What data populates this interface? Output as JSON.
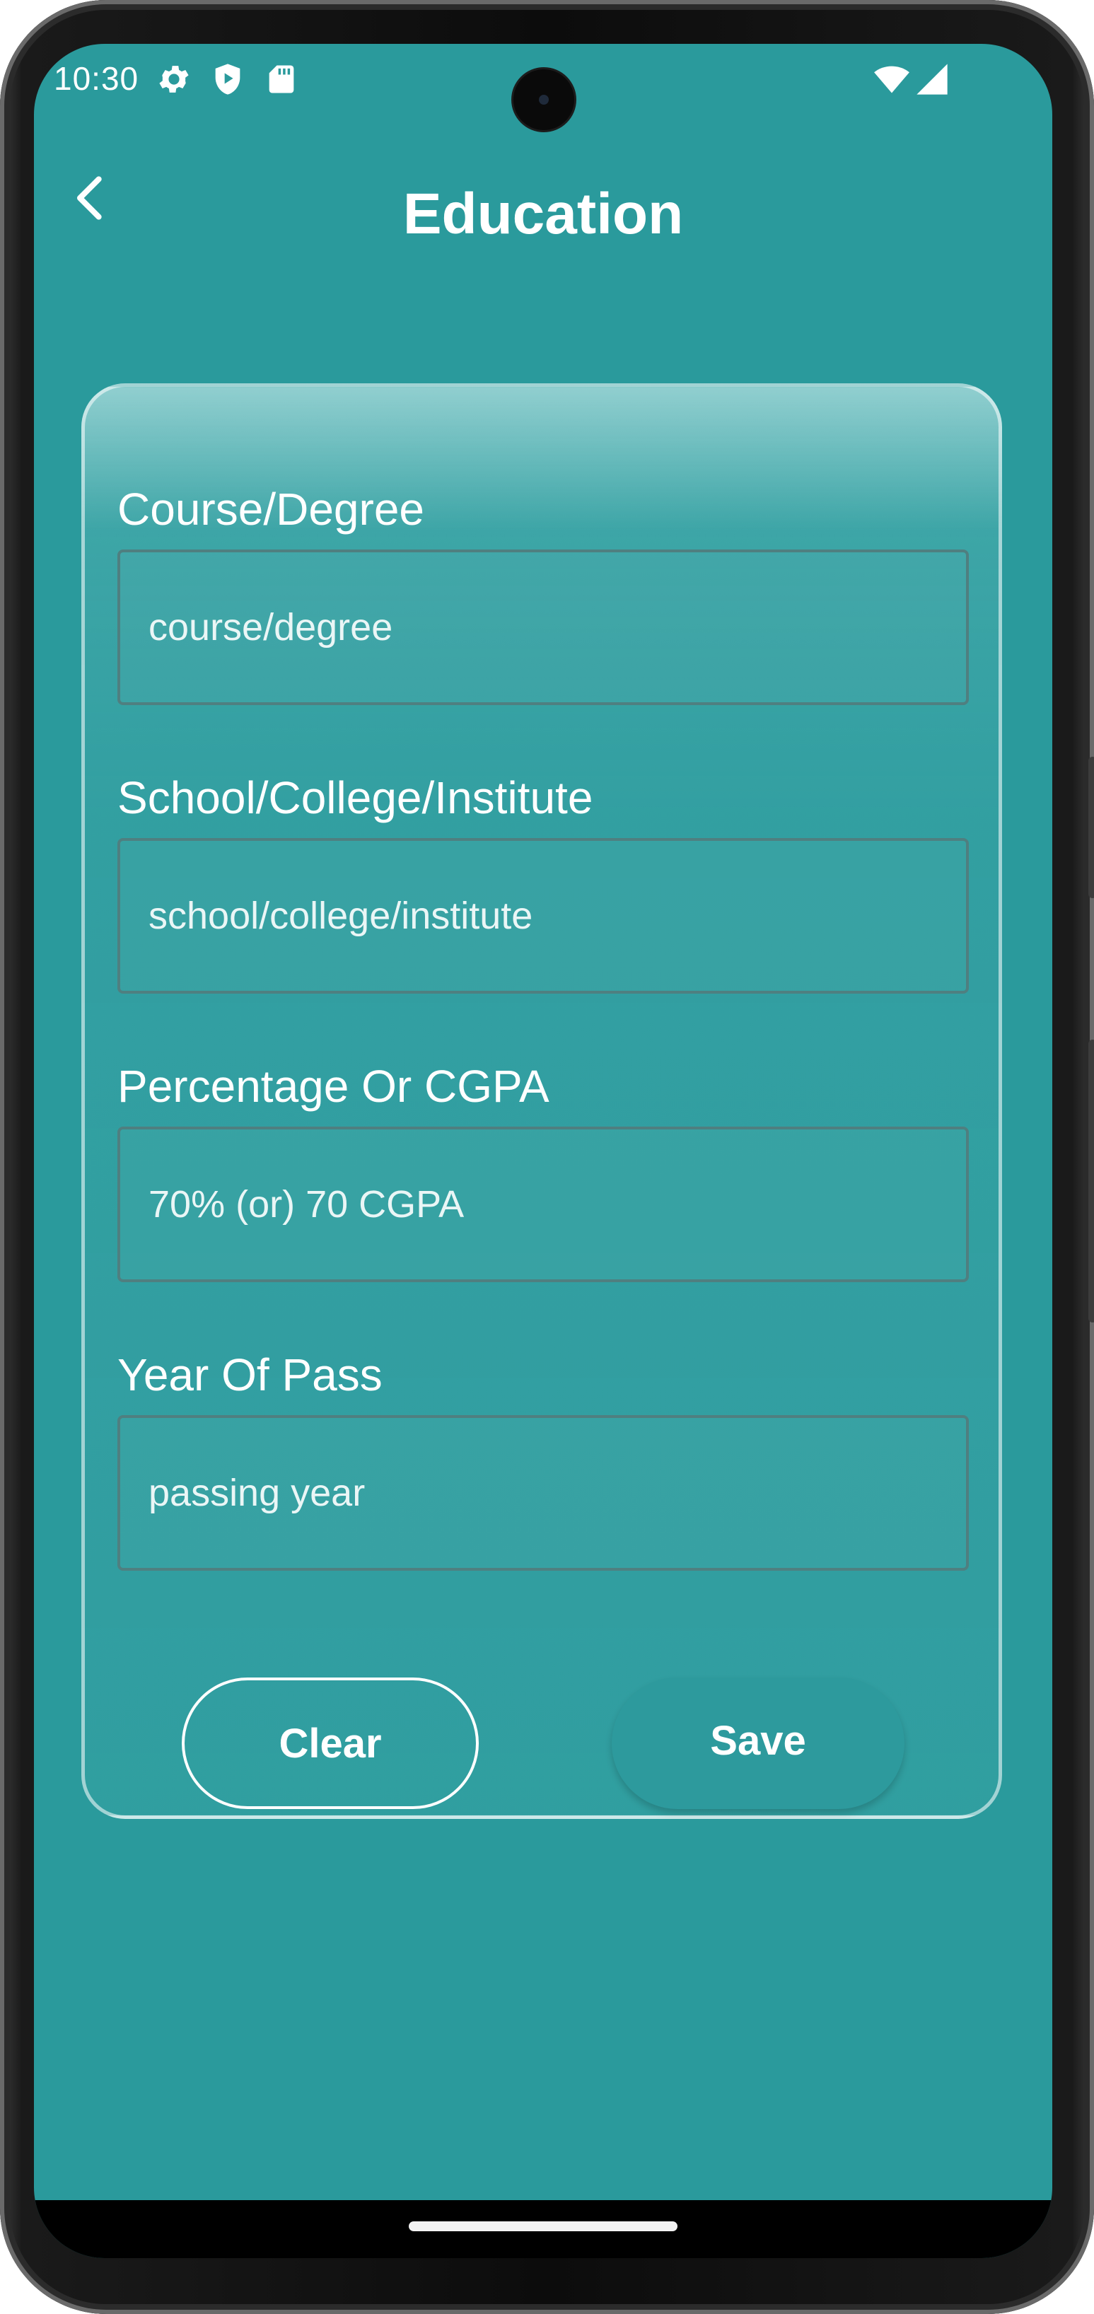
{
  "status_bar": {
    "time": "10:30",
    "left_icons": [
      "settings-icon",
      "shield-play-icon",
      "sd-card-icon"
    ],
    "right_icons": [
      "wifi-icon",
      "cell-signal-icon"
    ]
  },
  "header": {
    "title": "Education",
    "back_icon": "chevron-left-icon"
  },
  "form": {
    "fields": [
      {
        "label": "Course/Degree",
        "placeholder": "course/degree",
        "value": ""
      },
      {
        "label": "School/College/Institute",
        "placeholder": "school/college/institute",
        "value": ""
      },
      {
        "label": "Percentage Or CGPA",
        "placeholder": "70% (or) 70 CGPA",
        "value": ""
      },
      {
        "label": "Year Of Pass",
        "placeholder": "passing year",
        "value": ""
      }
    ],
    "clear_label": "Clear",
    "save_label": "Save"
  },
  "colors": {
    "background": "#2a9a9c",
    "save_button": "#2d9a9d",
    "text": "#ffffff"
  }
}
